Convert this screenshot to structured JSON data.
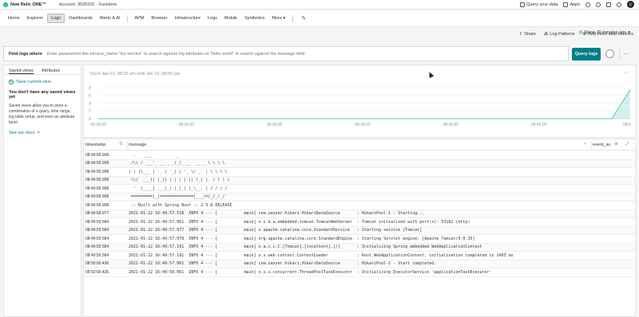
{
  "topbar": {
    "logo": "New Relic ONE™",
    "account": "Account: 3026225 - Sunstone",
    "query_label": "Query your data",
    "apps_label": "Apps",
    "avatar_initial": "C"
  },
  "nav": {
    "items": [
      "Home",
      "Explorer",
      "Logs",
      "Dashboards",
      "Alerts & AI"
    ],
    "items2": [
      "APM",
      "Browser",
      "Infrastructure",
      "Logs",
      "Mobile",
      "Synthetics",
      "More ▾"
    ],
    "active_index": 2
  },
  "actions": {
    "share": "Share",
    "log_patterns": "Log Patterns",
    "add_sources": "Add more data sources"
  },
  "timepicker": {
    "label": "Since 30 minutes ago"
  },
  "query": {
    "label": "Find logs where",
    "placeholder": "Enter parameters like service_name:\"my service\" to search against log attributes or \"hello world\" to search against the message field",
    "button": "Query logs"
  },
  "left_panel": {
    "tabs": [
      "Saved views",
      "Attributes"
    ],
    "save_current": "Save current view",
    "heading": "You don't have any saved views yet",
    "body": "Saved views allow you to store a combination of a query, time range, log table setup, and even an attribute facet.",
    "docs_link": "See our docs"
  },
  "chart_data": {
    "type": "area",
    "title": "Since Jan 22, 08:20 am until Jan 22, 08:50 am",
    "x": [
      "08:20:00",
      "08:25:00",
      "08:30:00",
      "08:35:00",
      "08:40:00",
      "08:45:00",
      "08:5"
    ],
    "yticks": [
      0,
      2,
      4,
      6,
      8
    ],
    "ylim": [
      0,
      8
    ],
    "series": [
      {
        "values": [
          0,
          0,
          0,
          0,
          0,
          0,
          0,
          0,
          0,
          0,
          0,
          0,
          0,
          0,
          0,
          0,
          0,
          0,
          0,
          0,
          0,
          0,
          0,
          0,
          0,
          0,
          0,
          0,
          0,
          7.5
        ]
      }
    ],
    "color": "#5ec3bd"
  },
  "table": {
    "columns": [
      "timestamp",
      "message",
      "event_su"
    ],
    "rows": [
      {
        "ts": "08:49:56.908",
        "msg": "  .   ____          _"
      },
      {
        "ts": "08:49:56.908",
        "msg": " /\\\\ / ___'_ __ _ _(_)_ __  __ _ \\ \\ \\ \\"
      },
      {
        "ts": "08:49:56.908",
        "msg": "( ( )\\___ | '_ | '_| | '_ \\/ _` | \\ \\ \\ \\"
      },
      {
        "ts": "08:49:56.908",
        "msg": " \\\\/  ___)| |_)| | | | | || (_| |  ) ) ) )"
      },
      {
        "ts": "08:49:56.908",
        "msg": "  '  |____| .__|_| |_|_| |_\\__, | / / / /"
      },
      {
        "ts": "08:49:56.908",
        "msg": " =========|_|==============|___/=/_/_/_/"
      },
      {
        "ts": "08:49:56.908",
        "msg": " :: Built with Spring Boot :: 2.3.0.RELEASE"
      },
      {
        "ts": "08:49:58.977",
        "msg": "2021-01-22 16:49:57.518  INFO 4 --- [           main] com.zaxxer.hikari.HikariDataSource       : HikariPool-1 - Starting..."
      },
      {
        "ts": "08:49:59.584",
        "msg": "2021-01-22 16:49:57.061  INFO 4 --- [           main] o.s.b.w.embedded.tomcat.TomcatWebServer  : Tomcat initialized with port(s): 53182 (http)"
      },
      {
        "ts": "08:49:59.584",
        "msg": "2021-01-22 16:49:57.077  INFO 4 --- [           main] o.apache.catalina.core.StandardService   : Starting service [Tomcat]"
      },
      {
        "ts": "08:49:59.584",
        "msg": "2021-01-22 16:49:57.078  INFO 4 --- [           main] org.apache.catalina.core.StandardEngine  : Starting Servlet engine: [Apache Tomcat/9.0.35]"
      },
      {
        "ts": "08:49:59.584",
        "msg": "2021-01-22 16:49:57.191  INFO 4 --- [           main] o.a.c.c.C.[Tomcat].[localhost].[/]       : Initializing Spring embedded WebApplicationContext"
      },
      {
        "ts": "08:49:59.584",
        "msg": "2021-01-22 16:49:57.191  INFO 4 --- [           main] o.s.web.context.ContextLoader            : Root WebApplicationContext: initialization completed in 2403 ms"
      },
      {
        "ts": "08:50:00.436",
        "msg": "2021-01-22 16:49:57.861  INFO 4 --- [           main] com.zaxxer.hikari.HikariDataSource       : HikariPool-1 - Start completed."
      },
      {
        "ts": "08:50:00.436",
        "msg": "2021-01-22 16:49:58.061  INFO 4 --- [           main] o.s.s.concurrent.ThreadPoolTaskExecutor  : Initializing ExecutorService 'applicationTaskExecutor'"
      }
    ]
  }
}
